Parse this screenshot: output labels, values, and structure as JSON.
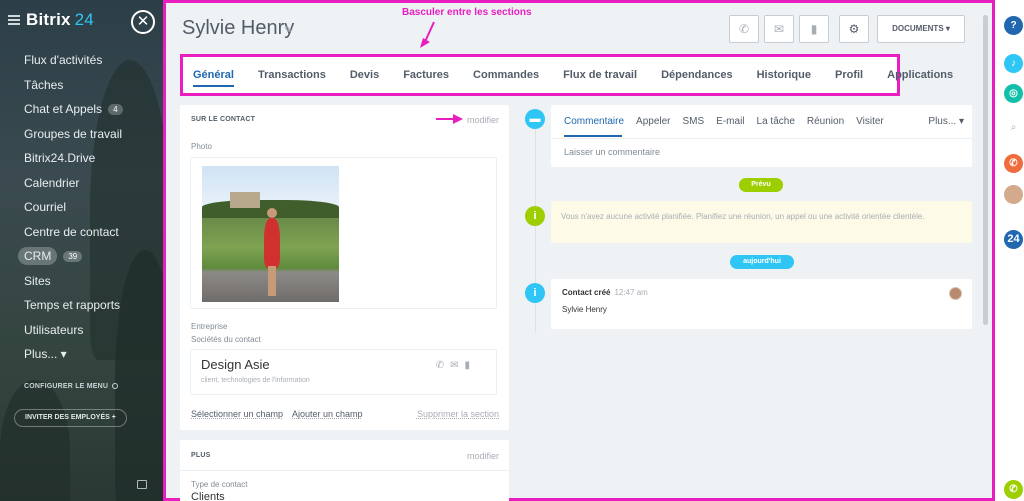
{
  "sidebar": {
    "logo": "Bitrix",
    "logo_num": "24",
    "close_symbol": "✕",
    "items": [
      {
        "label": "Flux d'activités"
      },
      {
        "label": "Tâches"
      },
      {
        "label": "Chat et Appels",
        "count": "4"
      },
      {
        "label": "Groupes de travail"
      },
      {
        "label": "Bitrix24.Drive"
      },
      {
        "label": "Calendrier"
      },
      {
        "label": "Courriel"
      },
      {
        "label": "Centre de contact"
      },
      {
        "label": "CRM",
        "count": "39"
      },
      {
        "label": "Sites"
      },
      {
        "label": "Temps et rapports"
      },
      {
        "label": "Utilisateurs"
      },
      {
        "label": "Plus... ▾"
      }
    ],
    "configure": "CONFIGURER LE MENU",
    "invite": "INVITER DES EMPLOYÉS  +"
  },
  "header": {
    "title": "Sylvie Henry",
    "edit_symbol": "✎",
    "call_symbol": "✆",
    "mail_symbol": "✉",
    "chat_symbol": "▮",
    "settings_symbol": "⚙",
    "documents_label": "DOCUMENTS ▾"
  },
  "annotation": {
    "switch_sections": "Basculer entre les sections"
  },
  "tabs": [
    {
      "label": "Général"
    },
    {
      "label": "Transactions"
    },
    {
      "label": "Devis"
    },
    {
      "label": "Factures"
    },
    {
      "label": "Commandes"
    },
    {
      "label": "Flux de travail"
    },
    {
      "label": "Dépendances"
    },
    {
      "label": "Historique"
    },
    {
      "label": "Profil"
    },
    {
      "label": "Applications"
    }
  ],
  "contact_card": {
    "heading": "SUR LE CONTACT",
    "edit_link": "modifier",
    "photo_label": "Photo",
    "company_label": "Entreprise",
    "companies_label": "Sociétés du contact",
    "company_name": "Design Asie",
    "company_sub": "client, technologies de l'information",
    "select_field": "Sélectionner un champ",
    "add_field": "Ajouter un champ",
    "delete_section": "Supprimer la section"
  },
  "more_card": {
    "heading": "PLUS",
    "edit_link": "modifier",
    "contact_type_label": "Type de contact",
    "contact_type_value": "Clients"
  },
  "composer": {
    "tabs": [
      "Commentaire",
      "Appeler",
      "SMS",
      "E-mail",
      "La tâche",
      "Réunion",
      "Visiter"
    ],
    "more": "Plus... ▾",
    "placeholder": "Laisser un commentaire"
  },
  "timeline": {
    "planned_pill": "Prévu",
    "planned_text": "Vous n'avez aucune activité planifiée. Planifiez une réunion, un appel ou une activité orientée clientèle.",
    "today_pill": "aujourd'hui",
    "event_title": "Contact créé",
    "event_time": "12:47 am",
    "event_name": "Sylvie Henry"
  },
  "rail": {
    "help": "?",
    "brand": "24"
  },
  "colors": {
    "accent": "#2067b0",
    "annotation": "#e91ec0",
    "composer_dot": "#2fc6f6",
    "planned_dot": "#9dcf00",
    "today_pill": "#2fc6f6"
  }
}
